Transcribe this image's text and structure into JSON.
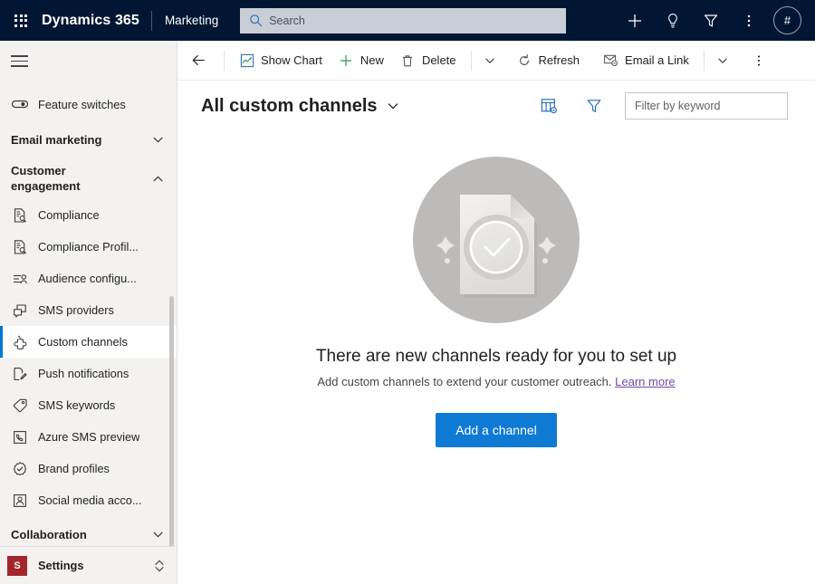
{
  "topbar": {
    "waffle_label": "app-launcher",
    "brand": "Dynamics 365",
    "app_name": "Marketing",
    "search": {
      "placeholder": "Search",
      "value": "",
      "icon": "search-icon"
    },
    "icons": [
      {
        "name": "add-icon",
        "glyph": "plus"
      },
      {
        "name": "lightbulb-icon",
        "glyph": "lightbulb"
      },
      {
        "name": "filter-icon",
        "glyph": "funnel"
      },
      {
        "name": "more-icon",
        "glyph": "ellipsis-vertical"
      }
    ],
    "avatar_initial": "#"
  },
  "sidebar": {
    "hamburger_label": "site-map-toggle",
    "feature_switches": {
      "label": "Feature switches",
      "icon": "toggle-icon"
    },
    "groups": [
      {
        "label": "Email marketing",
        "expanded": false,
        "chevron": "chevron-down"
      },
      {
        "label": "Customer engagement",
        "expanded": true,
        "chevron": "chevron-up"
      }
    ],
    "items": [
      {
        "label": "Compliance",
        "icon": "compliance-doc-icon",
        "selected": false
      },
      {
        "label": "Compliance Profil...",
        "icon": "compliance-doc-icon",
        "selected": false
      },
      {
        "label": "Audience configu...",
        "icon": "audience-config-icon",
        "selected": false
      },
      {
        "label": "SMS providers",
        "icon": "chat-bubbles-icon",
        "selected": false
      },
      {
        "label": "Custom channels",
        "icon": "puzzle-piece-icon",
        "selected": true
      },
      {
        "label": "Push notifications",
        "icon": "push-notification-icon",
        "selected": false
      },
      {
        "label": "SMS keywords",
        "icon": "tag-icon",
        "selected": false
      },
      {
        "label": "Azure SMS preview",
        "icon": "azure-sms-icon",
        "selected": false
      },
      {
        "label": "Brand profiles",
        "icon": "verified-badge-icon",
        "selected": false
      },
      {
        "label": "Social media acco...",
        "icon": "social-account-icon",
        "selected": false
      }
    ],
    "collaboration_group": {
      "label": "Collaboration",
      "chevron": "chevron-down"
    },
    "settings": {
      "badge": "S",
      "label": "Settings",
      "chevron": "chevron-up-down",
      "badge_color": "#a4262c"
    }
  },
  "commandbar": {
    "back_label": "back-arrow",
    "buttons": [
      {
        "label": "Show Chart",
        "icon": "show-chart-icon"
      },
      {
        "label": "New",
        "icon": "plus-icon"
      },
      {
        "label": "Delete",
        "icon": "trash-icon"
      },
      {
        "label": "Refresh",
        "icon": "refresh-icon"
      },
      {
        "label": "Email a Link",
        "icon": "email-link-icon"
      }
    ],
    "overflow_label": "more-commands"
  },
  "viewbar": {
    "title": "All custom channels",
    "title_caret": "chevron-down-icon",
    "edit_columns_icon": "edit-columns-icon",
    "filter_icon": "filter-funnel-icon",
    "filter_input": {
      "placeholder": "Filter by keyword",
      "value": ""
    }
  },
  "empty_state": {
    "illustration": "document-check-illustration",
    "title": "There are new channels ready for you to set up",
    "subtitle_text": "Add custom channels to extend your customer outreach.",
    "link_text": "Learn more",
    "button_label": "Add a channel"
  },
  "colors": {
    "topbar_bg": "#001633",
    "accent_blue": "#0078d4",
    "primary_button": "#0f7ad4",
    "sidebar_bg": "#f3f2f1",
    "settings_badge": "#a4262c",
    "link_purple": "#7448a6"
  }
}
